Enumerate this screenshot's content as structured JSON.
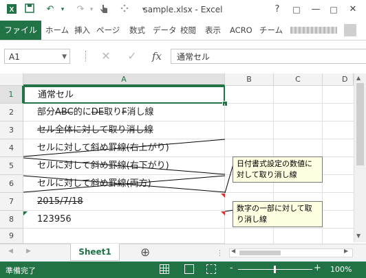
{
  "window": {
    "title": "sample.xlsx - Excel",
    "help": "?",
    "restore": "□",
    "minimize": "—",
    "maximize": "□",
    "close": "✕"
  },
  "quick_access": {
    "save": "💾",
    "undo": "↶",
    "redo": "↷",
    "touch": "✋",
    "customize": "▾"
  },
  "ribbon": {
    "file": "ファイル",
    "tabs": [
      "ホーム",
      "挿入",
      "ページ",
      "数式",
      "データ",
      "校閲",
      "表示",
      "ACRO",
      "チーム"
    ]
  },
  "formula_bar": {
    "name_box": "A1",
    "cancel": "✕",
    "enter": "✓",
    "fx": "fx",
    "content": "通常セル"
  },
  "columns": [
    "A",
    "B",
    "C",
    "D"
  ],
  "rows": [
    "1",
    "2",
    "3",
    "4",
    "5",
    "6",
    "7",
    "8",
    "9"
  ],
  "cells": {
    "a1": "通常セル",
    "a2_pre": "部分",
    "a2_strike1": "ABC",
    "a2_mid": "的に",
    "a2_strike2": "DE",
    "a2_mid2": "取り",
    "a2_strike3": "F",
    "a2_post": "消し線",
    "a3": "セル全体に対して取り消し線",
    "a4": "セルに対して斜め罫線(右上がり)",
    "a5": "セルに対して斜め罫線(右下がり)",
    "a6": "セルに対して斜め罫線(両方)",
    "a7": "2015/7/18",
    "a8": "123956"
  },
  "comments": [
    {
      "text": "日付書式設定の数値に対して取り消し線"
    },
    {
      "text": "数字の一部に対して取り消し線"
    }
  ],
  "sheets": {
    "active": "Sheet1",
    "add": "⊕"
  },
  "status": {
    "ready": "準備完了",
    "zoom": "100%",
    "zoom_minus": "-",
    "zoom_plus": "+"
  },
  "colors": {
    "accent": "#217346",
    "comment_bg": "#ffffe1"
  }
}
